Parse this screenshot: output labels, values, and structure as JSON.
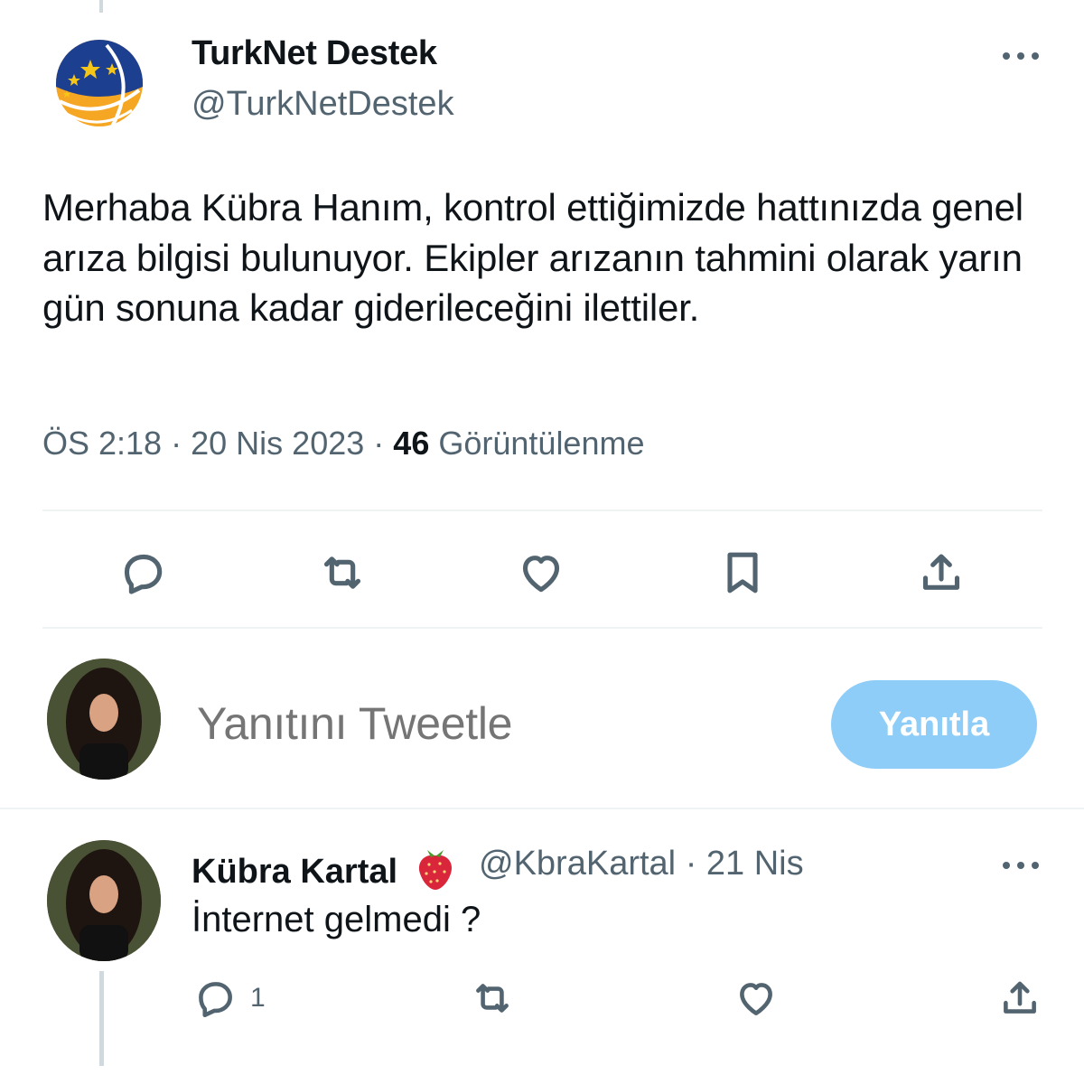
{
  "tweet": {
    "author_name": "TurkNet Destek",
    "author_handle": "@TurkNetDestek",
    "text": "Merhaba Kübra Hanım, kontrol ettiğimizde hattınızda genel arıza bilgisi bulunuyor. Ekipler arızanın tahmini olarak yarın gün sonuna kadar giderileceğini ilettiler.",
    "time": "ÖS 2:18",
    "date": "20 Nis 2023",
    "views_count": "46",
    "views_label": "Görüntülenme",
    "separator": "·"
  },
  "actions": {
    "icons": [
      "reply-icon",
      "retweet-icon",
      "like-icon",
      "bookmark-icon",
      "share-icon"
    ]
  },
  "compose": {
    "placeholder": "Yanıtını Tweetle",
    "button_label": "Yanıtla",
    "button_color": "#8ecdf8"
  },
  "reply": {
    "author_name": "Kübra Kartal",
    "author_emoji": "strawberry-icon",
    "author_handle": "@KbraKartal",
    "separator": "·",
    "date": "21 Nis",
    "text": "İnternet gelmedi ?",
    "reply_count": "1"
  },
  "colors": {
    "text_primary": "#0f1419",
    "text_secondary": "#536471",
    "divider": "#eff3f4"
  }
}
